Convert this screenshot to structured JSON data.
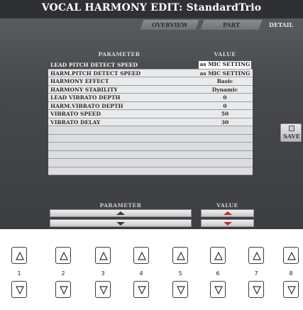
{
  "header": {
    "title": "VOCAL HARMONY EDIT: StandardTrio"
  },
  "tabs": [
    {
      "label": "OVERVIEW"
    },
    {
      "label": "PART"
    },
    {
      "label": "DETAIL"
    }
  ],
  "table": {
    "col_parameter": "PARAMETER",
    "col_value": "VALUE",
    "rows": [
      {
        "parameter": "LEAD PITCH DETECT SPEED",
        "value": "as MIC SETTING"
      },
      {
        "parameter": "HARM.PITCH DETECT SPEED",
        "value": "as MIC SETTING"
      },
      {
        "parameter": "HARMONY EFFECT",
        "value": "Basic"
      },
      {
        "parameter": "HARMONY STABILITY",
        "value": "Dynamic"
      },
      {
        "parameter": "LEAD VIBRATO DEPTH",
        "value": "0"
      },
      {
        "parameter": "HARM.VIBRATO DEPTH",
        "value": "0"
      },
      {
        "parameter": "VIBRATO SPEED",
        "value": "50"
      },
      {
        "parameter": "VIBRATO DELAY",
        "value": "30"
      }
    ]
  },
  "footer": {
    "parameter_label": "PARAMETER",
    "value_label": "VALUE"
  },
  "save": {
    "label": "SAVE"
  },
  "hardware_buttons": [
    "1",
    "2",
    "3",
    "4",
    "5",
    "6",
    "7",
    "8"
  ]
}
